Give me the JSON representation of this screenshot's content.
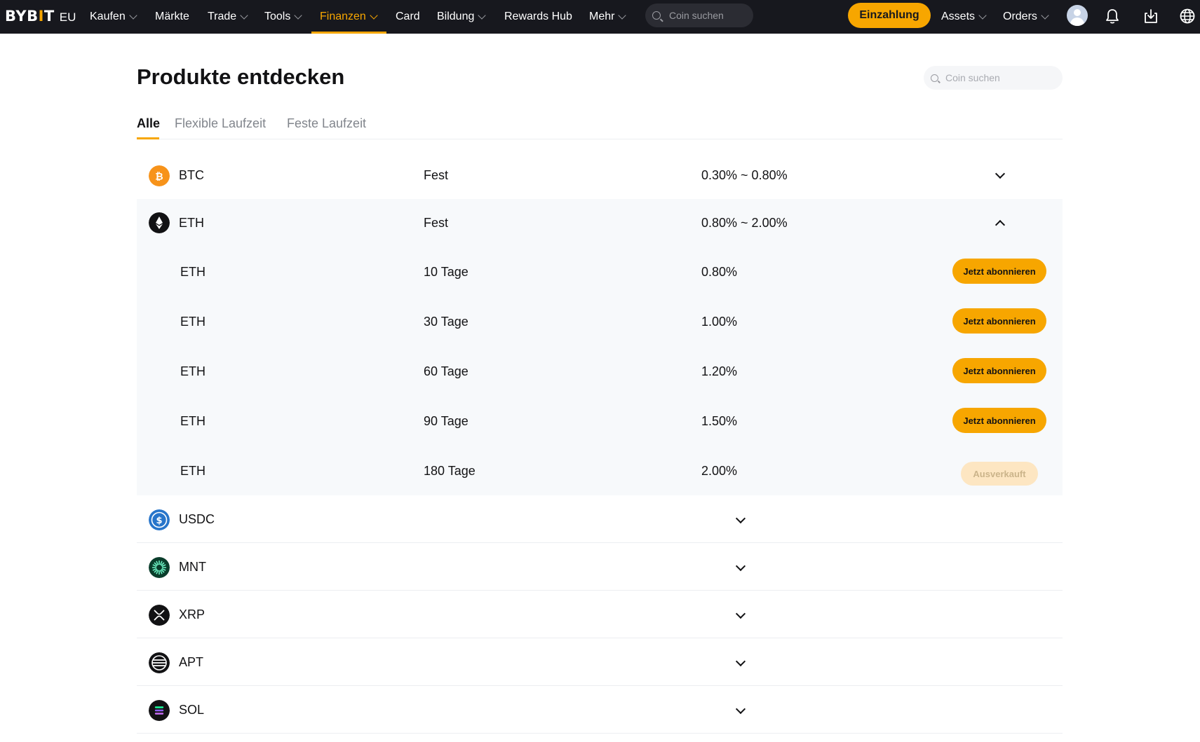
{
  "nav": {
    "logo_main": "BYBIT",
    "logo_sub": "EU",
    "items": [
      {
        "label": "Kaufen",
        "dropdown": true
      },
      {
        "label": "Märkte",
        "dropdown": false
      },
      {
        "label": "Trade",
        "dropdown": true
      },
      {
        "label": "Tools",
        "dropdown": true
      },
      {
        "label": "Finanzen",
        "dropdown": true,
        "active": true
      },
      {
        "label": "Card",
        "dropdown": false
      },
      {
        "label": "Bildung",
        "dropdown": true
      },
      {
        "label": "Rewards Hub",
        "dropdown": false
      },
      {
        "label": "Mehr",
        "dropdown": true
      }
    ],
    "search_placeholder": "Coin suchen",
    "deposit_label": "Einzahlung",
    "assets_label": "Assets",
    "orders_label": "Orders",
    "icons": [
      "avatar",
      "bell-icon",
      "download-icon",
      "globe-icon"
    ],
    "accent_color": "#f7a600"
  },
  "page": {
    "title": "Produkte entdecken",
    "search_placeholder": "Coin suchen",
    "tabs": [
      {
        "label": "Alle",
        "active": true
      },
      {
        "label": "Flexible Laufzeit",
        "active": false
      },
      {
        "label": "Feste Laufzeit",
        "active": false
      }
    ]
  },
  "products": [
    {
      "coin": "BTC",
      "type": "Fest",
      "apr": "0.30% ~ 0.80%",
      "expanded": false,
      "icon": "btc-icon",
      "color": "#f7931a"
    },
    {
      "coin": "ETH",
      "type": "Fest",
      "apr": "0.80% ~ 2.00%",
      "expanded": true,
      "icon": "eth-icon",
      "color": "#121214",
      "terms": [
        {
          "coin": "ETH",
          "term": "10 Tage",
          "apr": "0.80%",
          "action": "Jetzt abonnieren",
          "available": true
        },
        {
          "coin": "ETH",
          "term": "30 Tage",
          "apr": "1.00%",
          "action": "Jetzt abonnieren",
          "available": true
        },
        {
          "coin": "ETH",
          "term": "60 Tage",
          "apr": "1.20%",
          "action": "Jetzt abonnieren",
          "available": true
        },
        {
          "coin": "ETH",
          "term": "90 Tage",
          "apr": "1.50%",
          "action": "Jetzt abonnieren",
          "available": true
        },
        {
          "coin": "ETH",
          "term": "180 Tage",
          "apr": "2.00%",
          "action": "Ausverkauft",
          "available": false
        }
      ]
    },
    {
      "coin": "USDC",
      "expanded": false,
      "icon": "usdc-icon",
      "color": "#2775ca"
    },
    {
      "coin": "MNT",
      "expanded": false,
      "icon": "mnt-icon",
      "color": "#0a3d2b"
    },
    {
      "coin": "XRP",
      "expanded": false,
      "icon": "xrp-icon",
      "color": "#121214"
    },
    {
      "coin": "APT",
      "expanded": false,
      "icon": "apt-icon",
      "color": "#121214"
    },
    {
      "coin": "SOL",
      "expanded": false,
      "icon": "sol-icon",
      "color": "#121214"
    }
  ]
}
